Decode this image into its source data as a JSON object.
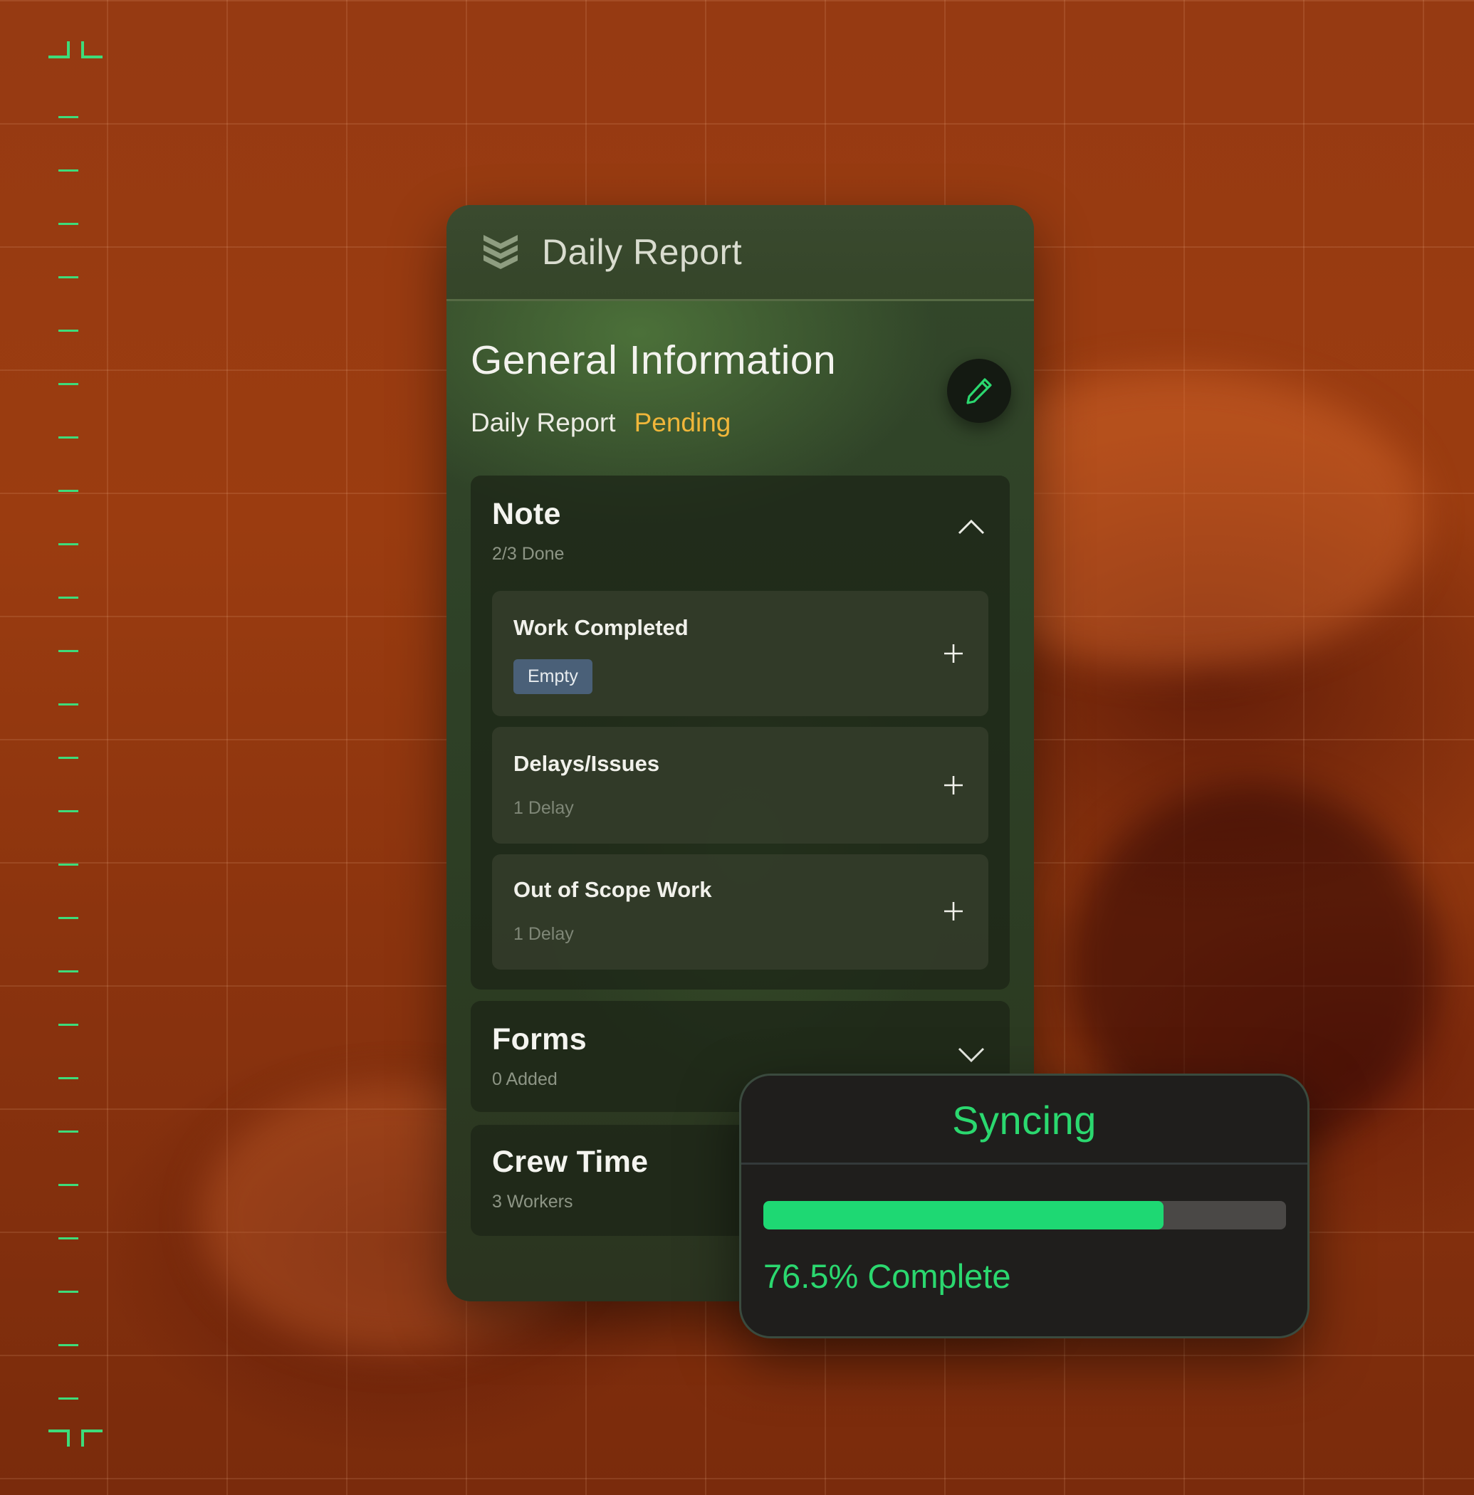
{
  "header": {
    "title": "Daily Report",
    "logo_icon": "stacked-chevrons-icon"
  },
  "general": {
    "title": "General Information",
    "report_label": "Daily Report",
    "status": "Pending",
    "edit_icon": "pencil-icon"
  },
  "sections": {
    "note": {
      "title": "Note",
      "subtitle": "2/3 Done",
      "expanded": true,
      "items": [
        {
          "title": "Work Completed",
          "badge": "Empty"
        },
        {
          "title": "Delays/Issues",
          "meta": "1 Delay"
        },
        {
          "title": "Out of Scope Work",
          "meta": "1 Delay"
        }
      ]
    },
    "forms": {
      "title": "Forms",
      "subtitle": "0 Added",
      "expanded": false
    },
    "crew": {
      "title": "Crew Time",
      "subtitle": "3 Workers"
    }
  },
  "sync": {
    "title": "Syncing",
    "progress": 0.765,
    "label": "76.5% Complete"
  },
  "colors": {
    "accent_green": "#2bd86f",
    "pending": "#f0b63a",
    "badge_bg": "#4a6078"
  }
}
